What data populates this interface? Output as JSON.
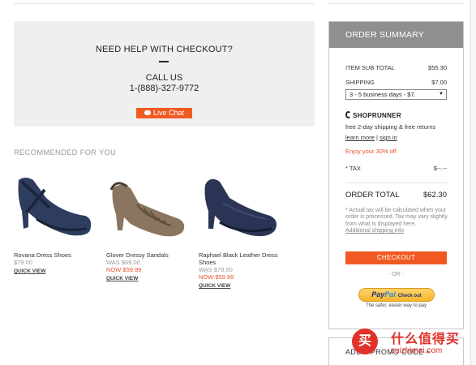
{
  "help": {
    "title": "NEED HELP WITH CHECKOUT?",
    "call_us": "CALL US",
    "phone": "1-(888)-327-9772",
    "live_chat": "Live Chat"
  },
  "recommended": {
    "title": "RECOMMENDED FOR YOU",
    "quick_view": "QUICK VIEW",
    "products": [
      {
        "name": "Rovana Dress Shoes",
        "price": "$79.00",
        "color": "#2e3d5e"
      },
      {
        "name": "Glover Dressy Sandals",
        "was": "WAS $69.00",
        "now": "NOW $59.99",
        "color": "#8a7560"
      },
      {
        "name": "Raphael Black Leather Dress Shoes",
        "was": "WAS $79.00",
        "now": "NOW $59.99",
        "color": "#2a3556"
      }
    ]
  },
  "summary": {
    "title": "ORDER SUMMARY",
    "subtotal_label": "ITEM SUB TOTAL",
    "subtotal_value": "$55.30",
    "shipping_label": "SHIPPING",
    "shipping_value": "$7.00",
    "shipping_option": "3 - 5 business days - $7.",
    "shoprunner_brand": "SHOPRUNNER",
    "shoprunner_text": "free 2-day shipping & free returns",
    "learn_more": "learn more",
    "sign_in": "sign in",
    "discount_text": "Enjoy your 30% off",
    "tax_label": "* TAX",
    "tax_value": "$--.--",
    "total_label": "ORDER TOTAL",
    "total_value": "$62.30",
    "tax_note": "* Actual tax will be calculated when your order is processed. Tax may vary slightly from what is displayed here.",
    "additional_shipping": "Additional shipping info",
    "checkout": "CHECKOUT",
    "or": "- OR -",
    "paypal_1": "Pay",
    "paypal_2": "Pal",
    "paypal_checkout": "Check out",
    "paypal_tagline": "The safer, easier way to pay"
  },
  "promo": {
    "label": "ADD A PROMO CODE +"
  },
  "watermark": {
    "top": "什么值得买",
    "bottom": "zuizhimai.com",
    "badge": "买"
  },
  "colors": {
    "accent": "#f05a22",
    "summary_header": "#8f8f8f",
    "help_bg": "#efefef"
  }
}
